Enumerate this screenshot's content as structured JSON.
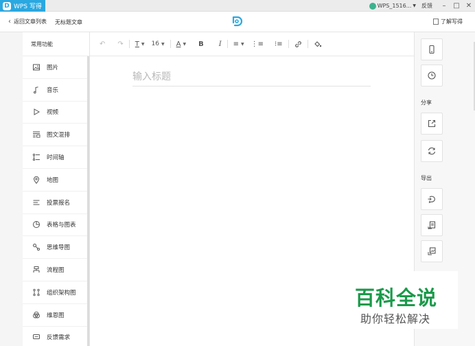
{
  "titlebar": {
    "app_name": "WPS 写得",
    "user": "WPS_1516...",
    "feedback": "反馈"
  },
  "nav": {
    "back_label": "返回文章列表",
    "doc_name": "无标题文章",
    "learn_label": "了解写得"
  },
  "sidebar": {
    "heading": "常用功能",
    "items": [
      {
        "label": "图片",
        "icon": "image-icon"
      },
      {
        "label": "音乐",
        "icon": "music-icon"
      },
      {
        "label": "视频",
        "icon": "video-icon"
      },
      {
        "label": "图文混排",
        "icon": "layout-icon"
      },
      {
        "label": "时间轴",
        "icon": "timeline-icon"
      },
      {
        "label": "地图",
        "icon": "map-pin-icon"
      },
      {
        "label": "投票报名",
        "icon": "vote-icon"
      },
      {
        "label": "表格与图表",
        "icon": "chart-icon"
      },
      {
        "label": "思维导图",
        "icon": "mindmap-icon"
      },
      {
        "label": "流程图",
        "icon": "flowchart-icon"
      },
      {
        "label": "组织架构图",
        "icon": "org-chart-icon"
      },
      {
        "label": "维恩图",
        "icon": "venn-icon"
      },
      {
        "label": "反馈需求",
        "icon": "feedback-icon"
      }
    ]
  },
  "toolbar": {
    "font_size": "16",
    "bold": "B",
    "italic": "I",
    "font_color": "A"
  },
  "editor": {
    "title_placeholder": "输入标题"
  },
  "right_panel": {
    "share_label": "分享",
    "export_label": "导出"
  },
  "watermark": {
    "title": "百科全说",
    "subtitle": "助你轻松解决"
  },
  "colors": {
    "accent": "#2aa8e0",
    "watermark_green": "#1a9a4a"
  }
}
